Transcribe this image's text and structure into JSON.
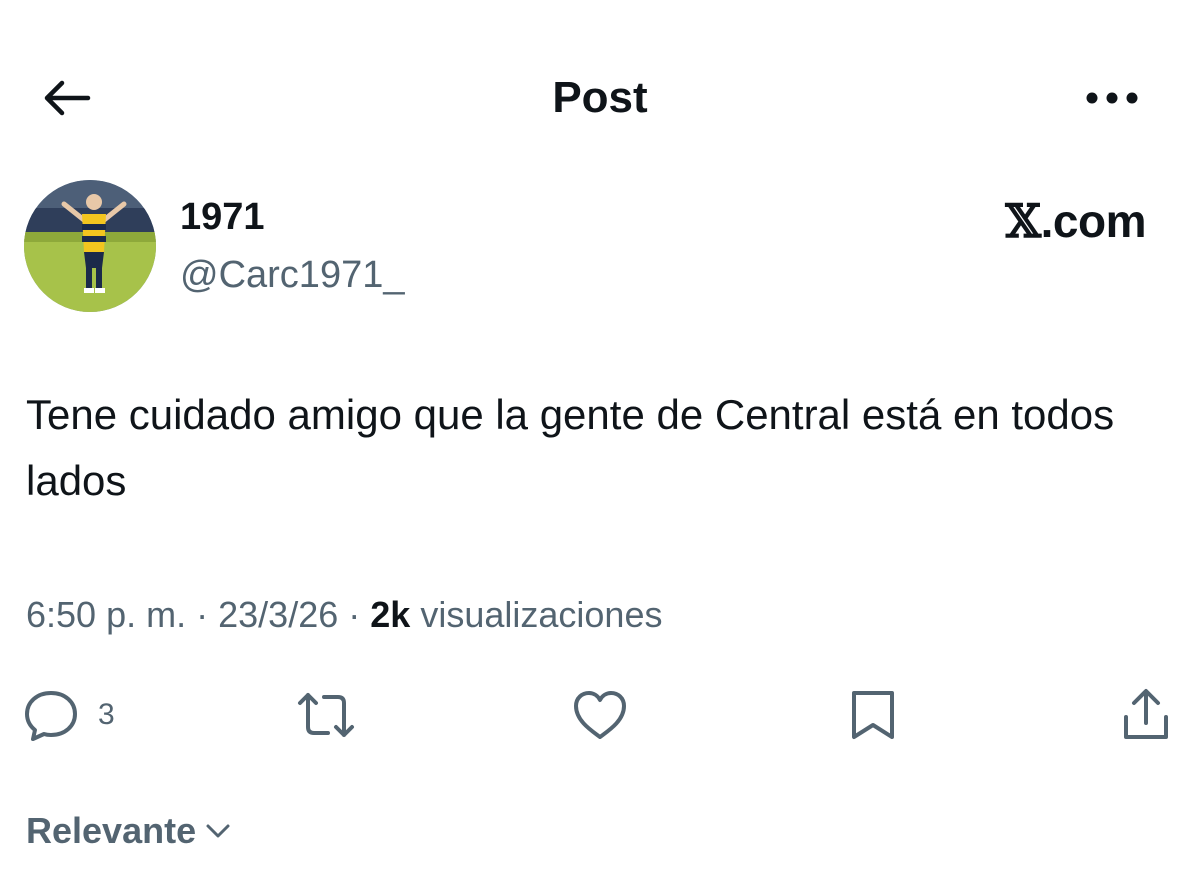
{
  "header": {
    "title": "Post",
    "back_icon": "arrow-left-icon",
    "more_icon": "more-horizontal-icon"
  },
  "post": {
    "display_name": "1971",
    "handle": "@Carc1971_",
    "brand_x": "𝕏",
    "brand_suffix": ".com",
    "text": "Tene cuidado amigo que la gente de Central está en todos lados",
    "time": "6:50 p. m.",
    "separator": "·",
    "date": "23/3/26",
    "views_count": "2k",
    "views_label": "visualizaciones"
  },
  "actions": {
    "reply": {
      "icon": "reply-bubble-icon",
      "count": "3"
    },
    "repost": {
      "icon": "repost-icon"
    },
    "like": {
      "icon": "heart-icon"
    },
    "bookmark": {
      "icon": "bookmark-icon"
    },
    "share": {
      "icon": "share-icon"
    }
  },
  "sort": {
    "label": "Relevante",
    "icon": "chevron-down-icon"
  },
  "colors": {
    "text_primary": "#0f1419",
    "text_secondary": "#536471",
    "background": "#ffffff"
  }
}
